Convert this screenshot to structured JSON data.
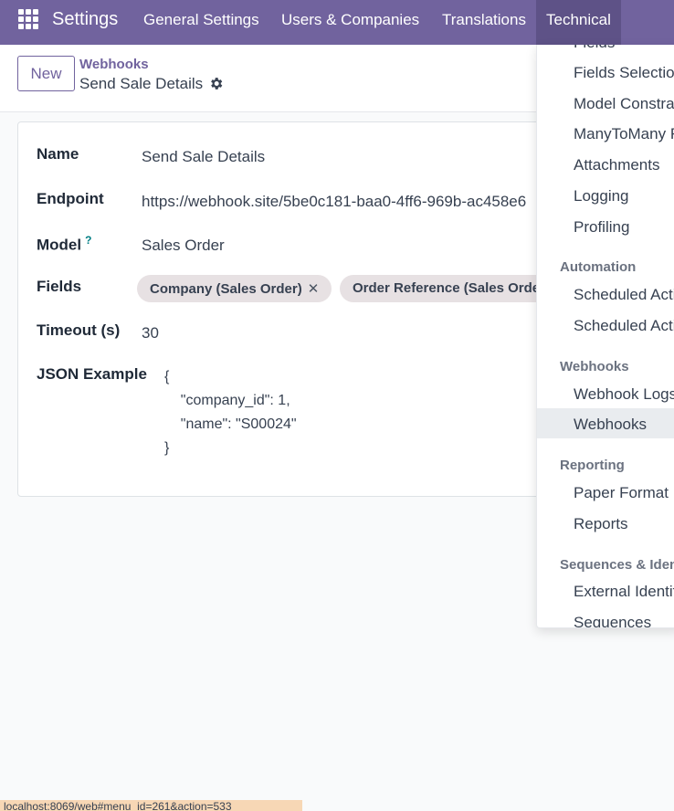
{
  "topbar": {
    "app_title": "Settings",
    "nav": [
      "General Settings",
      "Users & Companies",
      "Translations",
      "Technical"
    ]
  },
  "control_panel": {
    "new_label": "New",
    "breadcrumb_parent": "Webhooks",
    "breadcrumb_current": "Send Sale Details"
  },
  "form": {
    "name_label": "Name",
    "name_value": "Send Sale Details",
    "endpoint_label": "Endpoint",
    "endpoint_value": "https://webhook.site/5be0c181-baa0-4ff6-969b-ac458e6",
    "model_label": "Model",
    "model_help": "?",
    "model_value": "Sales Order",
    "fields_label": "Fields",
    "fields_tags": [
      "Company (Sales Order)",
      "Order Reference (Sales Order)"
    ],
    "tag_remove": "✕",
    "timeout_label": "Timeout (s)",
    "timeout_value": "30",
    "json_label": "JSON Example",
    "json_lines": [
      "{",
      "    \"company_id\": 1,",
      "    \"name\": \"S00024\"",
      "}"
    ]
  },
  "dropdown": {
    "cut_top": "Fields",
    "items_a": [
      "Fields Selection",
      "Model Constraints",
      "ManyToMany Relations",
      "Attachments",
      "Logging",
      "Profiling"
    ],
    "head_automation": "Automation",
    "items_automation": [
      "Scheduled Actions",
      "Scheduled Actions Triggers"
    ],
    "head_webhooks": "Webhooks",
    "items_webhooks": [
      "Webhook Logs",
      "Webhooks"
    ],
    "head_reporting": "Reporting",
    "items_reporting": [
      "Paper Format",
      "Reports"
    ],
    "head_sequences": "Sequences & Identifiers",
    "items_sequences": [
      "External Identifiers",
      "Sequences"
    ]
  },
  "statusbar": "localhost:8069/web#menu_id=261&action=533",
  "colors": {
    "brand": "#71639e",
    "brand_dark": "#5e5287",
    "tag_bg": "#e7e1e3"
  }
}
